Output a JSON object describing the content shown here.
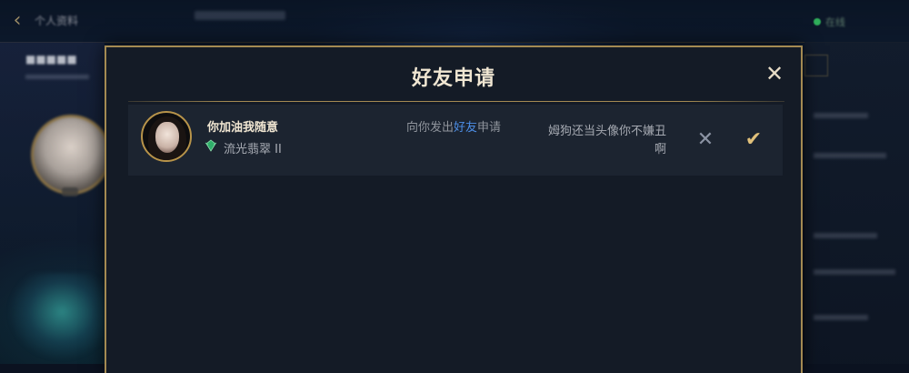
{
  "background": {
    "back_icon": "chevron-left-icon",
    "profile_tab_label": "个人资料",
    "status_label": "在线"
  },
  "modal": {
    "title": "好友申请",
    "close_icon": "close-icon"
  },
  "requests": [
    {
      "nickname": "你加油我随意",
      "rank_icon": "emerald-rank-icon",
      "rank": "流光翡翠 II",
      "request_prefix": "向你发出",
      "request_highlight": "好友",
      "request_suffix": "申请",
      "message": "姆狗还当头像你不嫌丑啊",
      "decline_icon": "x-icon",
      "accept_icon": "check-icon"
    }
  ],
  "colors": {
    "accent_gold": "#a48a52",
    "highlight_blue": "#4d8ee6",
    "title_text": "#f0e6d2",
    "accept_gold": "#e0c07a"
  }
}
